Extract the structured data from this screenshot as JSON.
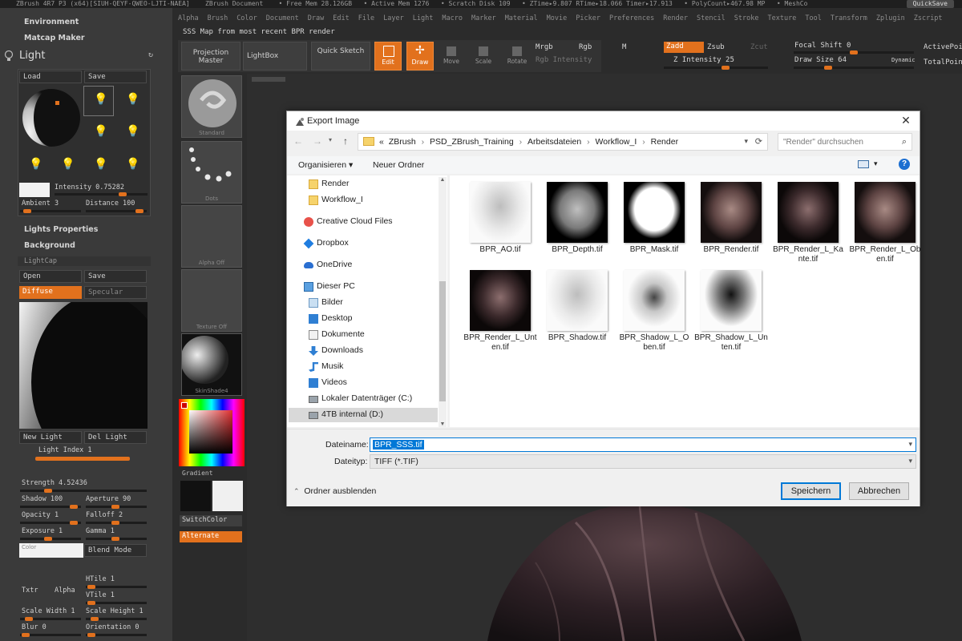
{
  "titlebar": {
    "app": "ZBrush 4R7 P3 (x64)[SIUH-QEYF-QWEO-LJTI-NAEA]",
    "document": "ZBrush Document",
    "free_mem": "• Free Mem 28.126GB",
    "active_mem": "• Active Mem 1276",
    "scratch": "• Scratch Disk 109",
    "ztime": "• ZTime▸9.807 RTime▸18.066 Timer▸17.913",
    "polycount": "• PolyCount▸467.98 MP",
    "meshcount": "• MeshCo",
    "quicksave": "QuickSave"
  },
  "menubar": [
    "Alpha",
    "Brush",
    "Color",
    "Document",
    "Draw",
    "Edit",
    "File",
    "Layer",
    "Light",
    "Macro",
    "Marker",
    "Material",
    "Movie",
    "Picker",
    "Preferences",
    "Render",
    "Stencil",
    "Stroke",
    "Texture",
    "Tool",
    "Transform",
    "Zplugin",
    "Zscript"
  ],
  "sss_note": "SSS Map from most recent BPR render",
  "left": {
    "environment": "Environment",
    "matcap_maker": "Matcap Maker",
    "light_title": "Light",
    "load": "Load",
    "save": "Save",
    "intensity": "Intensity 0.75282",
    "ambient": "Ambient 3",
    "distance": "Distance 100",
    "lights_properties": "Lights Properties",
    "background": "Background",
    "lightcap": "LightCap",
    "open": "Open",
    "save2": "Save",
    "diffuse": "Diffuse",
    "specular": "Specular",
    "new_light": "New Light",
    "del_light": "Del Light",
    "light_index": "Light Index 1",
    "strength": "Strength 4.52436",
    "shadow": "Shadow 100",
    "aperture": "Aperture 90",
    "opacity": "Opacity 1",
    "falloff": "Falloff 2",
    "exposure": "Exposure 1",
    "gamma": "Gamma 1",
    "color": "Color",
    "blend_mode": "Blend Mode",
    "htile": "HTile 1",
    "txtr": "Txtr",
    "alpha": "Alpha",
    "vtile": "VTile 1",
    "scale_width": "Scale Width 1",
    "scale_height": "Scale Height 1",
    "blur": "Blur 0",
    "orientation": "Orientation 0"
  },
  "toolbar": {
    "projection_master": "Projection Master",
    "lightbox": "LightBox",
    "quick_sketch": "Quick Sketch",
    "edit": "Edit",
    "draw": "Draw",
    "move": "Move",
    "scale": "Scale",
    "rotate": "Rotate",
    "mrgb": "Mrgb",
    "rgb": "Rgb",
    "m": "M",
    "rgb_intensity": "Rgb Intensity",
    "zadd": "Zadd",
    "zsub": "Zsub",
    "zcut": "Zcut",
    "z_intensity": "Z Intensity 25",
    "focal_shift": "Focal Shift 0",
    "draw_size": "Draw Size 64",
    "dynamic": "Dynamic",
    "active_points": "ActivePoi",
    "total_points": "TotalPoint"
  },
  "brushcol": {
    "standard": "Standard",
    "dots": "Dots",
    "alpha_off": "Alpha Off",
    "texture_off": "Texture Off",
    "material": "SkinShade4",
    "gradient": "Gradient",
    "switchcolor": "SwitchColor",
    "alternate": "Alternate"
  },
  "dialog": {
    "title": "Export Image",
    "close": "✕",
    "breadcrumb_prefix": "«",
    "breadcrumb": [
      "ZBrush",
      "PSD_ZBrush_Training",
      "Arbeitsdateien",
      "Workflow_I",
      "Render"
    ],
    "search_placeholder": "\"Render\" durchsuchen",
    "organize": "Organisieren",
    "new_folder": "Neuer Ordner",
    "nav": [
      {
        "label": "Render",
        "icon": "folder-icon"
      },
      {
        "label": "Workflow_I",
        "icon": "folder-icon"
      },
      {
        "label": "Creative Cloud Files",
        "icon": "creative-cloud-icon"
      },
      {
        "label": "Dropbox",
        "icon": "dropbox-icon"
      },
      {
        "label": "OneDrive",
        "icon": "onedrive-icon"
      },
      {
        "label": "Dieser PC",
        "icon": "computer-icon"
      },
      {
        "label": "Bilder",
        "icon": "pictures-icon"
      },
      {
        "label": "Desktop",
        "icon": "desktop-icon"
      },
      {
        "label": "Dokumente",
        "icon": "documents-icon"
      },
      {
        "label": "Downloads",
        "icon": "downloads-icon"
      },
      {
        "label": "Musik",
        "icon": "music-icon"
      },
      {
        "label": "Videos",
        "icon": "videos-icon"
      },
      {
        "label": "Lokaler Datenträger (C:)",
        "icon": "drive-icon"
      },
      {
        "label": "4TB internal (D:)",
        "icon": "drive-icon"
      }
    ],
    "files": [
      {
        "name": "BPR_AO.tif",
        "tone": "ao"
      },
      {
        "name": "BPR_Depth.tif",
        "tone": "depth"
      },
      {
        "name": "BPR_Mask.tif",
        "tone": "mask"
      },
      {
        "name": "BPR_Render.tif",
        "tone": "render"
      },
      {
        "name": "BPR_Render_L_Kante.tif",
        "tone": "render-dark"
      },
      {
        "name": "BPR_Render_L_Oben.tif",
        "tone": "render"
      },
      {
        "name": "BPR_Render_L_Unten.tif",
        "tone": "render-dark"
      },
      {
        "name": "BPR_Shadow.tif",
        "tone": "ao"
      },
      {
        "name": "BPR_Shadow_L_Oben.tif",
        "tone": "shadow"
      },
      {
        "name": "BPR_Shadow_L_Unten.tif",
        "tone": "shadow-dark"
      }
    ],
    "filename_label": "Dateiname:",
    "filename_value": "BPR_SSS.tif",
    "filetype_label": "Dateityp:",
    "filetype_value": "TIFF (*.TIF)",
    "hide_folders": "Ordner ausblenden",
    "save": "Speichern",
    "cancel": "Abbrechen"
  },
  "colors": {
    "accent": "#e2711d",
    "win_blue": "#0078d7"
  }
}
